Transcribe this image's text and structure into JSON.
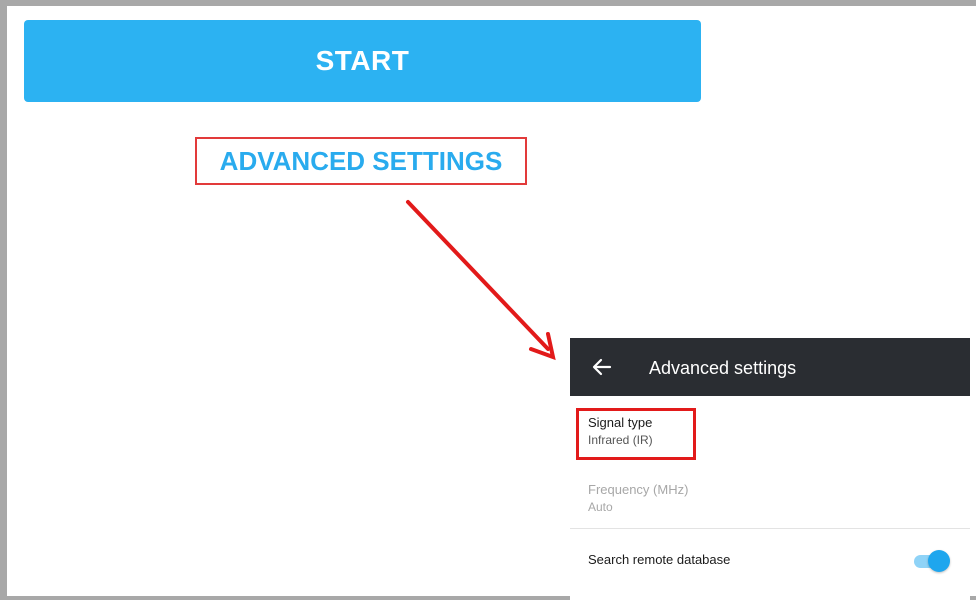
{
  "start_button": {
    "label": "START"
  },
  "advanced_link": {
    "label": "ADVANCED SETTINGS"
  },
  "panel": {
    "app_bar": {
      "back_icon": "arrow-left-icon",
      "title": "Advanced settings"
    },
    "signal_type": {
      "title": "Signal type",
      "value": "Infrared (IR)"
    },
    "frequency": {
      "title": "Frequency (MHz)",
      "value": "Auto",
      "enabled": false
    },
    "search_remote_database": {
      "label": "Search remote database",
      "toggle_on": true
    }
  },
  "colors": {
    "start_button": "#2cb2f2",
    "link_text": "#29abee",
    "highlight_border": "#e21a1a",
    "app_bar": "#2a2d32",
    "toggle": "#1ea6ee"
  }
}
